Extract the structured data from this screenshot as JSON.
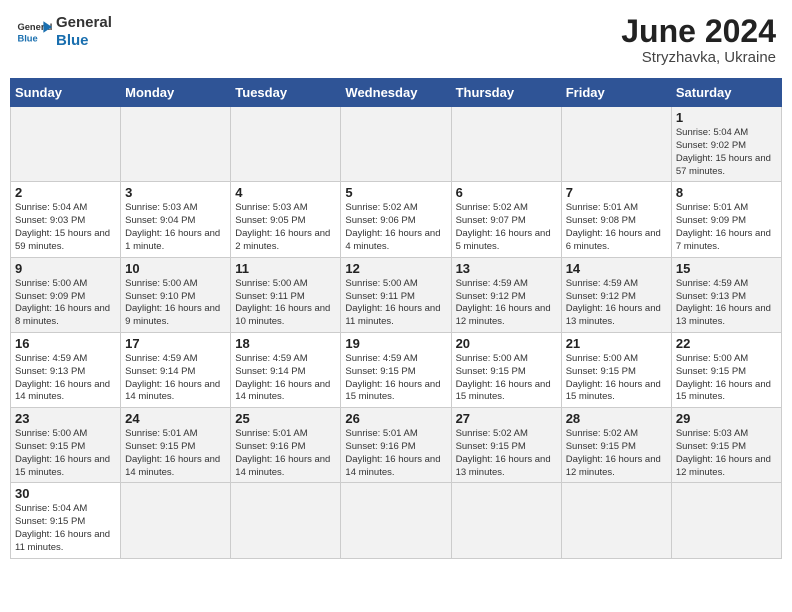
{
  "header": {
    "logo_general": "General",
    "logo_blue": "Blue",
    "month_title": "June 2024",
    "subtitle": "Stryzhavka, Ukraine"
  },
  "days_of_week": [
    "Sunday",
    "Monday",
    "Tuesday",
    "Wednesday",
    "Thursday",
    "Friday",
    "Saturday"
  ],
  "weeks": [
    [
      {
        "day": "",
        "info": ""
      },
      {
        "day": "",
        "info": ""
      },
      {
        "day": "",
        "info": ""
      },
      {
        "day": "",
        "info": ""
      },
      {
        "day": "",
        "info": ""
      },
      {
        "day": "",
        "info": ""
      },
      {
        "day": "1",
        "info": "Sunrise: 5:04 AM\nSunset: 9:02 PM\nDaylight: 15 hours and 57 minutes."
      }
    ],
    [
      {
        "day": "2",
        "info": "Sunrise: 5:04 AM\nSunset: 9:03 PM\nDaylight: 15 hours and 59 minutes."
      },
      {
        "day": "3",
        "info": "Sunrise: 5:03 AM\nSunset: 9:04 PM\nDaylight: 16 hours and 1 minute."
      },
      {
        "day": "4",
        "info": "Sunrise: 5:03 AM\nSunset: 9:05 PM\nDaylight: 16 hours and 2 minutes."
      },
      {
        "day": "5",
        "info": "Sunrise: 5:02 AM\nSunset: 9:06 PM\nDaylight: 16 hours and 4 minutes."
      },
      {
        "day": "6",
        "info": "Sunrise: 5:02 AM\nSunset: 9:07 PM\nDaylight: 16 hours and 5 minutes."
      },
      {
        "day": "7",
        "info": "Sunrise: 5:01 AM\nSunset: 9:08 PM\nDaylight: 16 hours and 6 minutes."
      },
      {
        "day": "8",
        "info": "Sunrise: 5:01 AM\nSunset: 9:09 PM\nDaylight: 16 hours and 7 minutes."
      }
    ],
    [
      {
        "day": "9",
        "info": "Sunrise: 5:00 AM\nSunset: 9:09 PM\nDaylight: 16 hours and 8 minutes."
      },
      {
        "day": "10",
        "info": "Sunrise: 5:00 AM\nSunset: 9:10 PM\nDaylight: 16 hours and 9 minutes."
      },
      {
        "day": "11",
        "info": "Sunrise: 5:00 AM\nSunset: 9:11 PM\nDaylight: 16 hours and 10 minutes."
      },
      {
        "day": "12",
        "info": "Sunrise: 5:00 AM\nSunset: 9:11 PM\nDaylight: 16 hours and 11 minutes."
      },
      {
        "day": "13",
        "info": "Sunrise: 4:59 AM\nSunset: 9:12 PM\nDaylight: 16 hours and 12 minutes."
      },
      {
        "day": "14",
        "info": "Sunrise: 4:59 AM\nSunset: 9:12 PM\nDaylight: 16 hours and 13 minutes."
      },
      {
        "day": "15",
        "info": "Sunrise: 4:59 AM\nSunset: 9:13 PM\nDaylight: 16 hours and 13 minutes."
      }
    ],
    [
      {
        "day": "16",
        "info": "Sunrise: 4:59 AM\nSunset: 9:13 PM\nDaylight: 16 hours and 14 minutes."
      },
      {
        "day": "17",
        "info": "Sunrise: 4:59 AM\nSunset: 9:14 PM\nDaylight: 16 hours and 14 minutes."
      },
      {
        "day": "18",
        "info": "Sunrise: 4:59 AM\nSunset: 9:14 PM\nDaylight: 16 hours and 14 minutes."
      },
      {
        "day": "19",
        "info": "Sunrise: 4:59 AM\nSunset: 9:15 PM\nDaylight: 16 hours and 15 minutes."
      },
      {
        "day": "20",
        "info": "Sunrise: 5:00 AM\nSunset: 9:15 PM\nDaylight: 16 hours and 15 minutes."
      },
      {
        "day": "21",
        "info": "Sunrise: 5:00 AM\nSunset: 9:15 PM\nDaylight: 16 hours and 15 minutes."
      },
      {
        "day": "22",
        "info": "Sunrise: 5:00 AM\nSunset: 9:15 PM\nDaylight: 16 hours and 15 minutes."
      }
    ],
    [
      {
        "day": "23",
        "info": "Sunrise: 5:00 AM\nSunset: 9:15 PM\nDaylight: 16 hours and 15 minutes."
      },
      {
        "day": "24",
        "info": "Sunrise: 5:01 AM\nSunset: 9:15 PM\nDaylight: 16 hours and 14 minutes."
      },
      {
        "day": "25",
        "info": "Sunrise: 5:01 AM\nSunset: 9:16 PM\nDaylight: 16 hours and 14 minutes."
      },
      {
        "day": "26",
        "info": "Sunrise: 5:01 AM\nSunset: 9:16 PM\nDaylight: 16 hours and 14 minutes."
      },
      {
        "day": "27",
        "info": "Sunrise: 5:02 AM\nSunset: 9:15 PM\nDaylight: 16 hours and 13 minutes."
      },
      {
        "day": "28",
        "info": "Sunrise: 5:02 AM\nSunset: 9:15 PM\nDaylight: 16 hours and 12 minutes."
      },
      {
        "day": "29",
        "info": "Sunrise: 5:03 AM\nSunset: 9:15 PM\nDaylight: 16 hours and 12 minutes."
      }
    ],
    [
      {
        "day": "30",
        "info": "Sunrise: 5:04 AM\nSunset: 9:15 PM\nDaylight: 16 hours and 11 minutes."
      },
      {
        "day": "",
        "info": ""
      },
      {
        "day": "",
        "info": ""
      },
      {
        "day": "",
        "info": ""
      },
      {
        "day": "",
        "info": ""
      },
      {
        "day": "",
        "info": ""
      },
      {
        "day": "",
        "info": ""
      }
    ]
  ]
}
